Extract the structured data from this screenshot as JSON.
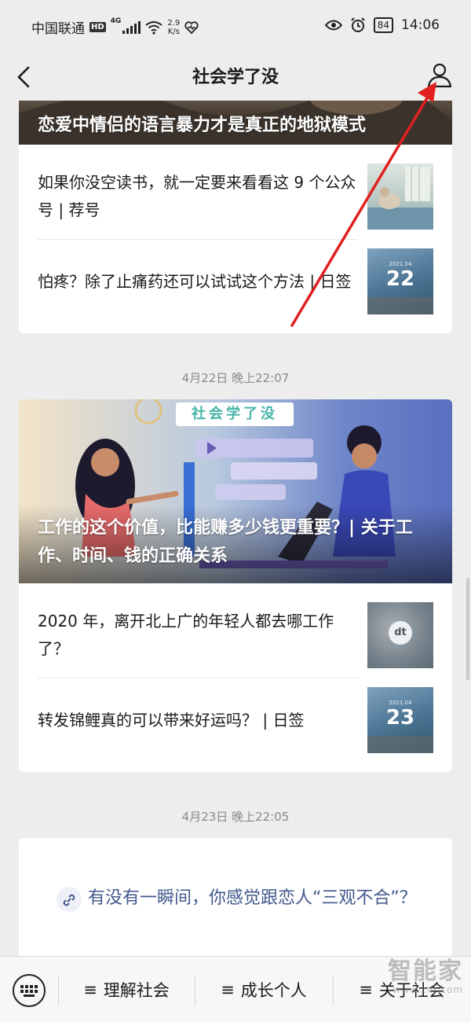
{
  "status_bar": {
    "carrier": "中国联通",
    "hd_label": "HD",
    "network": "4G",
    "speed_value": "2.9",
    "speed_unit": "K/s",
    "battery": "84",
    "time": "14:06"
  },
  "nav": {
    "title": "社会学了没"
  },
  "feed": {
    "card1": {
      "cover_title": "恋爱中情侣的语言暴力才是真正的地狱模式",
      "items": [
        {
          "title": "如果你没空读书，就一定要来看看这 9 个公众号 | 荐号",
          "thumb": "room-photo"
        },
        {
          "title": "怕疼？除了止痛药还可以试试这个方法 | 日签",
          "thumb_day": "22",
          "thumb_date": "2021.04"
        }
      ]
    },
    "timestamp2": "4月22日 晚上22:07",
    "card2": {
      "banner_text": "社会学了没",
      "cover_title": "工作的这个价值，比能赚多少钱更重要？| 关于工作、时间、钱的正确关系",
      "items": [
        {
          "title": "2020 年，离开北上广的年轻人都去哪工作了？",
          "thumb_logo": "dt"
        },
        {
          "title": "转发锦鲤真的可以带来好运吗？ | 日签",
          "thumb_day": "23",
          "thumb_date": "2021.04"
        }
      ]
    },
    "timestamp3": "4月23日 晚上22:05",
    "card3": {
      "text": "有没有一瞬间，你感觉跟恋人“三观不合”？"
    }
  },
  "bottom_menu": {
    "items": [
      {
        "label": "理解社会",
        "glyph": "≡"
      },
      {
        "label": "成长个人",
        "glyph": "≡"
      },
      {
        "label": "关于社会",
        "glyph": "≡"
      }
    ]
  },
  "watermark": {
    "text": "智能家",
    "url": "www.znj.com"
  },
  "colors": {
    "background": "#ededed",
    "link_text": "#40588c",
    "annotation_arrow": "#e02020"
  }
}
